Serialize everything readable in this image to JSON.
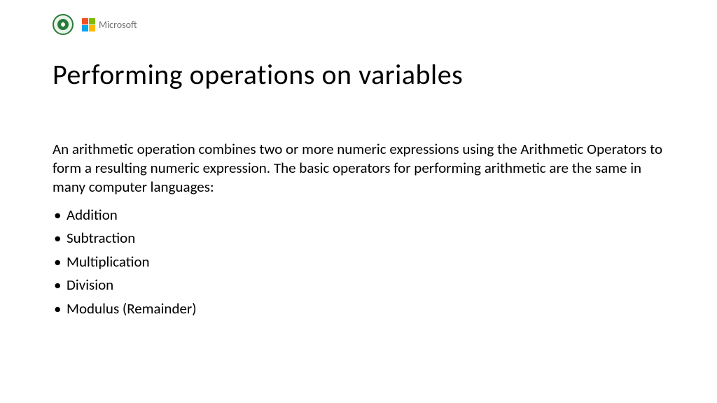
{
  "header": {
    "microsoft_label": "Microsoft"
  },
  "slide": {
    "title": "Performing operations on variables",
    "intro": "An arithmetic operation combines two or more numeric expressions using the Arithmetic Operators to form a resulting numeric expression. The basic operators for performing arithmetic are the same in many computer languages:",
    "bullets": [
      "Addition",
      "Subtraction",
      "Multiplication",
      "Division",
      "Modulus (Remainder)"
    ]
  }
}
